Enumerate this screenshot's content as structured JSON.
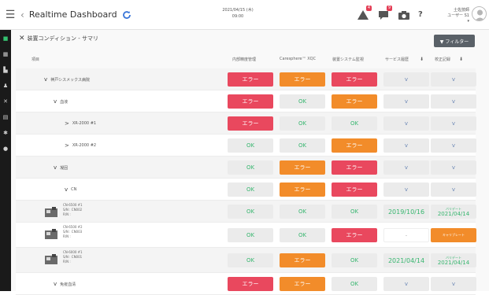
{
  "app": {
    "title": "Realtime Dashboard",
    "date": "2021/04/15 (木)",
    "time": "09:00"
  },
  "user": {
    "name_line1": "土佐技師",
    "name_line2": "ユーザー S1 ▾"
  },
  "notifications": {
    "alerts": "4",
    "messages": "9"
  },
  "icons": {
    "menu": "menu-icon",
    "back": "chevron-left-icon",
    "refresh": "refresh-icon",
    "alert": "alert-icon",
    "message": "message-icon",
    "camera": "camera-icon",
    "help": "help-icon",
    "user": "user-avatar-icon"
  },
  "section": {
    "title": "装置コンディション - サマリ",
    "filter_label": "▼ フィルター"
  },
  "columns": {
    "item": "項目",
    "internal": "内部精度管理",
    "caresphere": "Caresphere™ XQC",
    "system": "装置システム監視",
    "service": "サービス履歴",
    "calibration": "校正記録"
  },
  "rows": [
    {
      "name": "神戸シスメックス病院",
      "indent": 0,
      "chevron": "v",
      "internal": "エラー",
      "caresphere": "エラー",
      "system": "エラー",
      "service": "v",
      "calibration": "v"
    },
    {
      "name": "血液",
      "indent": 1,
      "chevron": "v",
      "internal": "エラー",
      "caresphere": "OK",
      "system": "エラー",
      "service": "v",
      "calibration": "v"
    },
    {
      "name": "XR-2000 #1",
      "indent": 2,
      "chevron": ">",
      "internal": "エラー",
      "caresphere": "OK",
      "system": "OK",
      "service": "v",
      "calibration": "v"
    },
    {
      "name": "XR-2000 #2",
      "indent": 2,
      "chevron": ">",
      "internal": "OK",
      "caresphere": "OK",
      "system": "エラー",
      "service": "v",
      "calibration": "v"
    },
    {
      "name": "凝固",
      "indent": 1,
      "chevron": "v",
      "internal": "OK",
      "caresphere": "エラー",
      "system": "エラー",
      "service": "v",
      "calibration": "v"
    },
    {
      "name": "CN",
      "indent": 2,
      "chevron": "v",
      "internal": "OK",
      "caresphere": "エラー",
      "system": "エラー",
      "service": "v",
      "calibration": "v"
    },
    {
      "name": "CN-6500 #1",
      "sn": "S/N : CN002",
      "rn": "R/N :",
      "indent": 3,
      "device": "analyzer-icon",
      "internal": "OK",
      "caresphere": "OK",
      "system": "OK",
      "service": "2019/10/16",
      "calibration_top": "バリデート",
      "calibration": "2021/04/14"
    },
    {
      "name": "CN-6500 #2",
      "sn": "S/N : CN003",
      "rn": "R/N :",
      "indent": 3,
      "device": "analyzer-icon",
      "internal": "OK",
      "caresphere": "OK",
      "system": "エラー",
      "service": "-",
      "calibration": "キャリブレート"
    },
    {
      "name": "CN-6000 #1",
      "sn": "S/N : CN001",
      "rn": "R/N :",
      "indent": 3,
      "device": "analyzer-icon",
      "internal": "OK",
      "caresphere": "エラー",
      "system": "OK",
      "service": "2021/04/14",
      "calibration_top": "バリデート",
      "calibration": "2021/04/14"
    },
    {
      "name": "免疫血清",
      "indent": 1,
      "chevron": "v",
      "internal": "エラー",
      "caresphere": "エラー",
      "system": "OK",
      "service": "v",
      "calibration": "v"
    }
  ],
  "colors": {
    "error_red": "#e9485e",
    "error_orange": "#f28c2a",
    "ok_green": "#37b66f",
    "sidebar": "#1a1a1a",
    "accent_green": "#35c270"
  }
}
